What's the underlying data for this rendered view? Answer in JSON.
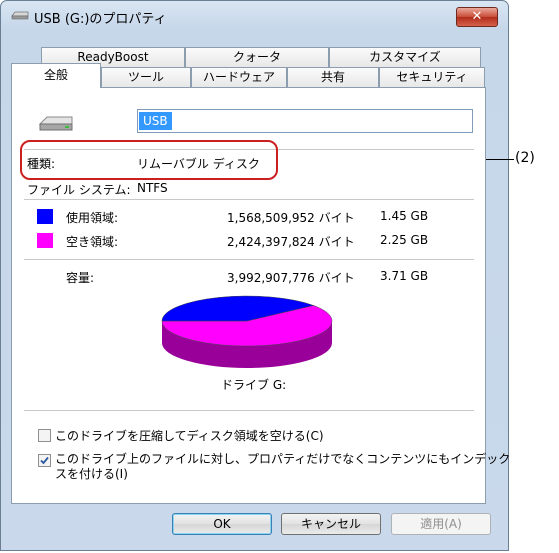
{
  "window": {
    "title": "USB (G:)のプロパティ",
    "close_label": "✕"
  },
  "tabs_top": [
    "ReadyBoost",
    "クォータ",
    "カスタマイズ"
  ],
  "tabs_bottom": [
    "全般",
    "ツール",
    "ハードウェア",
    "共有",
    "セキュリティ"
  ],
  "general": {
    "drive_name": "USB",
    "type_label": "種類:",
    "type_value": "リムーバブル ディスク",
    "fs_label": "ファイル システム:",
    "fs_value": "NTFS",
    "used": {
      "label": "使用領域:",
      "bytes": "1,568,509,952 バイト",
      "size": "1.45 GB",
      "color": "#0000ff"
    },
    "free": {
      "label": "空き領域:",
      "bytes": "2,424,397,824 バイト",
      "size": "2.25 GB",
      "color": "#ff00ff"
    },
    "capacity": {
      "label": "容量:",
      "bytes": "3,992,907,776 バイト",
      "size": "3.71 GB"
    },
    "pie": {
      "used_fraction": 0.393,
      "used_color": "#0000ff",
      "free_color": "#ff00ff"
    },
    "drive_label": "ドライブ G:",
    "compress_label": "このドライブを圧縮してディスク領域を空ける(C)",
    "compress_checked": false,
    "index_label_line1": "このドライブ上のファイルに対し、プロパティだけでなくコンテンツにもインデック",
    "index_label_line2": "スを付ける(I)",
    "index_checked": true
  },
  "buttons": {
    "ok": "OK",
    "cancel": "キャンセル",
    "apply": "適用(A)"
  },
  "callout": "(2)"
}
